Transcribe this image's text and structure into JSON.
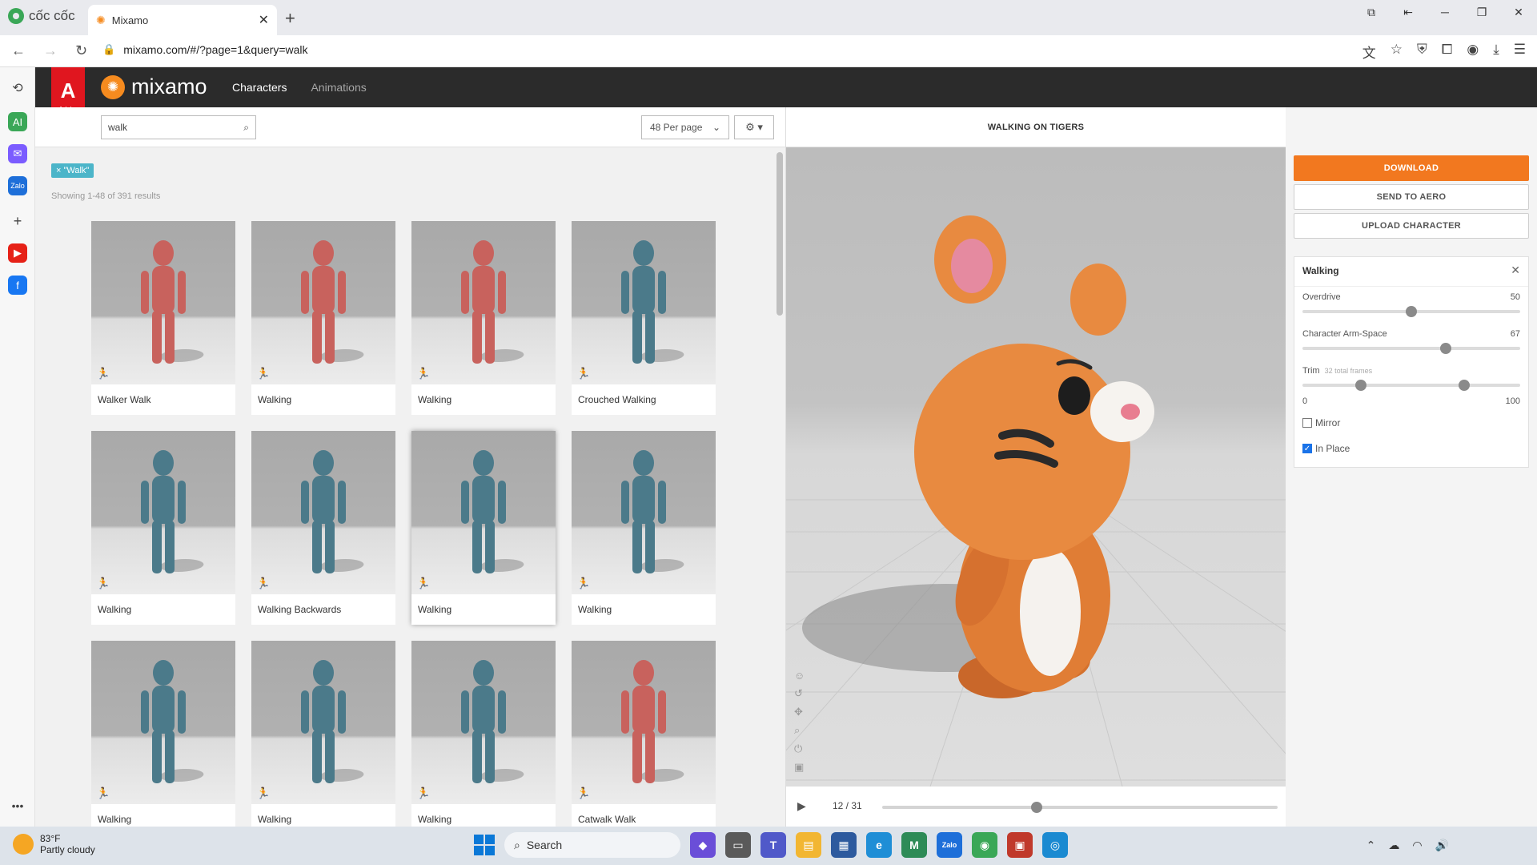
{
  "browser": {
    "brand": "cốc cốc",
    "tab_title": "Mixamo",
    "url": "mixamo.com/#/?page=1&query=walk"
  },
  "mixamo": {
    "adobe_label": "Adobe",
    "logo_text": "mixamo",
    "nav": {
      "characters": "Characters",
      "animations": "Animations"
    }
  },
  "search": {
    "query": "walk",
    "per_page": "48 Per page",
    "filter_tag": "× \"Walk\"",
    "showing": "Showing 1-48 of 391 results"
  },
  "results": [
    {
      "label": "Walker Walk",
      "color": "#c8625d"
    },
    {
      "label": "Walking",
      "color": "#c8625d"
    },
    {
      "label": "Walking",
      "color": "#c8625d"
    },
    {
      "label": "Crouched Walking",
      "color": "#4b7a8a"
    },
    {
      "label": "Walking",
      "color": "#4b7a8a"
    },
    {
      "label": "Walking Backwards",
      "color": "#4b7a8a"
    },
    {
      "label": "Walking",
      "color": "#4b7a8a"
    },
    {
      "label": "Walking",
      "color": "#4b7a8a"
    },
    {
      "label": "Walking",
      "color": "#4b7a8a"
    },
    {
      "label": "Walking",
      "color": "#4b7a8a"
    },
    {
      "label": "Walking",
      "color": "#4b7a8a"
    },
    {
      "label": "Catwalk Walk",
      "color": "#c8625d"
    }
  ],
  "viewer": {
    "title": "WALKING ON TIGERS",
    "frame": "12 / 31",
    "progress": 0.39
  },
  "actions": {
    "download": "DOWNLOAD",
    "send_to_aero": "SEND TO AERO",
    "upload_character": "UPLOAD CHARACTER"
  },
  "animation_panel": {
    "title": "Walking",
    "overdrive_label": "Overdrive",
    "overdrive_value": "50",
    "armspace_label": "Character Arm-Space",
    "armspace_value": "67",
    "trim_label": "Trim",
    "trim_sub": "32 total frames",
    "trim_min": "0",
    "trim_max": "100",
    "mirror_label": "Mirror",
    "mirror_checked": false,
    "inplace_label": "In Place",
    "inplace_checked": true
  },
  "taskbar": {
    "temp": "83°F",
    "weather": "Partly cloudy",
    "search": "Search"
  }
}
